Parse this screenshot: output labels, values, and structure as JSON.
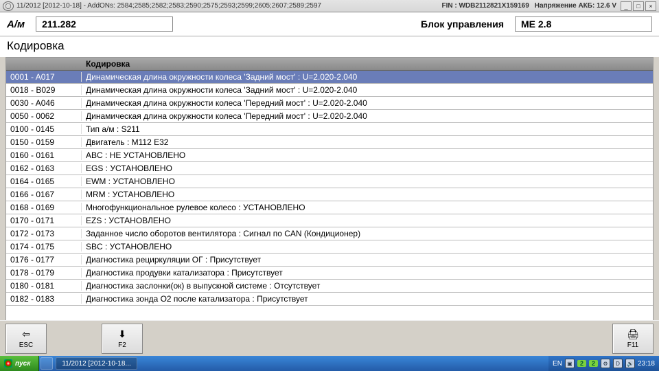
{
  "titlebar": {
    "version": "11/2012 [2012-10-18] - AddONs: 2584;2585;2582;2583;2590;2575;2593;2599;2605;2607;2589;2597",
    "fin_label": "FIN :",
    "fin_value": "WDB2112821X159169",
    "voltage": "Напряжение АКБ: 12.6 V"
  },
  "header": {
    "am_label": "А/м",
    "am_value": "211.282",
    "ecu_label": "Блок управления",
    "ecu_value": "ME 2.8"
  },
  "subtitle": "Кодировка",
  "table": {
    "head_code": "",
    "head_desc": "Кодировка",
    "rows": [
      {
        "code": "0001 - A017",
        "desc": "Динамическая длина окружности колеса 'Задний мост' : U=2.020-2.040",
        "selected": true
      },
      {
        "code": "0018 - B029",
        "desc": "Динамическая длина окружности колеса 'Задний мост' : U=2.020-2.040"
      },
      {
        "code": "0030 - A046",
        "desc": "Динамическая длина окружности колеса 'Передний мост' : U=2.020-2.040"
      },
      {
        "code": "0050 - 0062",
        "desc": "Динамическая длина окружности колеса 'Передний мост' : U=2.020-2.040"
      },
      {
        "code": "0100 - 0145",
        "desc": "Тип а/м : S211"
      },
      {
        "code": "0150 - 0159",
        "desc": "Двигатель : M112 E32"
      },
      {
        "code": "0160 - 0161",
        "desc": "ABC : НЕ УСТАНОВЛЕНО"
      },
      {
        "code": "0162 - 0163",
        "desc": "EGS : УСТАНОВЛЕНО"
      },
      {
        "code": "0164 - 0165",
        "desc": "EWM : УСТАНОВЛЕНО"
      },
      {
        "code": "0166 - 0167",
        "desc": "MRM : УСТАНОВЛЕНО"
      },
      {
        "code": "0168 - 0169",
        "desc": "Многофункциональное рулевое колесо : УСТАНОВЛЕНО"
      },
      {
        "code": "0170 - 0171",
        "desc": "EZS : УСТАНОВЛЕНО"
      },
      {
        "code": "0172 - 0173",
        "desc": "Заданное число оборотов вентилятора : Сигнал по CAN (Кондиционер)"
      },
      {
        "code": "0174 - 0175",
        "desc": "SBC : УСТАНОВЛЕНО"
      },
      {
        "code": "0176 - 0177",
        "desc": "Диагностика рециркуляции ОГ : Присутствует"
      },
      {
        "code": "0178 - 0179",
        "desc": "Диагностика продувки катализатора : Присутствует"
      },
      {
        "code": "0180 - 0181",
        "desc": "Диагностика заслонки(ок) в выпускной системе : Отсутствует"
      },
      {
        "code": "0182 - 0183",
        "desc": "Диагностика зонда O2 после катализатора : Присутствует"
      }
    ]
  },
  "footer": {
    "esc": "ESC",
    "f2": "F2",
    "f11": "F11"
  },
  "taskbar": {
    "start": "пуск",
    "item1": "",
    "item2": "11/2012 [2012-10-18...",
    "lang": "EN",
    "clock": "23:18"
  }
}
